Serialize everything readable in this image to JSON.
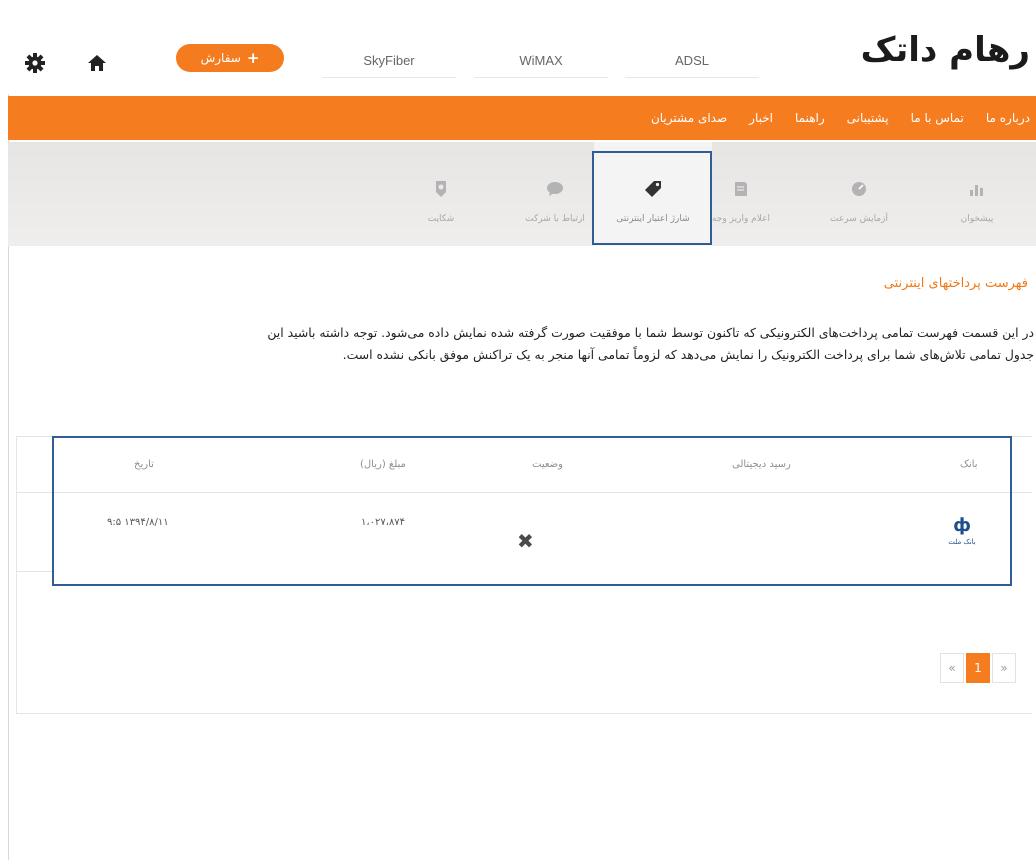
{
  "header": {
    "logo": "رهام داتک",
    "services": [
      "ADSL",
      "WiMAX",
      "SkyFiber"
    ],
    "order_button": "سفارش"
  },
  "nav": {
    "items": [
      "درباره ما",
      "تماس با ما",
      "پشتیبانی",
      "راهنما",
      "اخبار",
      "صدای مشتریان"
    ]
  },
  "tabs": [
    {
      "label": "پیشخوان",
      "icon": "chart-icon"
    },
    {
      "label": "آزمایش سرعت",
      "icon": "speedometer-icon"
    },
    {
      "label": "اعلام واریز وجه",
      "icon": "receipt-icon"
    },
    {
      "label": "شارژ اعتبار اینترنتی",
      "icon": "tag-icon",
      "active": true
    },
    {
      "label": "ارتباط با شرکت",
      "icon": "chat-bubble-icon"
    },
    {
      "label": "شکایت",
      "icon": "badge-icon"
    }
  ],
  "content": {
    "section_title": "فهرست پرداختهای اینترنتی",
    "description_line1": "در این قسمت فهرست تمامی پرداخت‌های الکترونیکی که تاکنون توسط شما با موفقیت صورت گرفته شده نمایش داده می‌شود. توجه داشته باشید این",
    "description_line2": "جدول تمامی تلاش‌های شما برای پرداخت الکترونیک را نمایش می‌دهد که لزوماً تمامی آنها منجر به یک تراکنش موفق بانکی نشده است."
  },
  "table": {
    "headers": {
      "bank": "بانک",
      "receipt": "رسید دیجیتالی",
      "status": "وضعیت",
      "amount": "مبلغ (ریال)",
      "date": "تاریخ"
    },
    "rows": [
      {
        "bank": "بانک ملت",
        "receipt": "",
        "status": "failed",
        "amount": "۱،۰۲۷،۸۷۴",
        "date": "۹:۵ ۱۳۹۴/۸/۱۱"
      }
    ]
  },
  "pagination": {
    "prev": "«",
    "current": "1",
    "next": "»"
  },
  "colors": {
    "brand_orange": "#f57d20",
    "highlight_blue": "#2f5d94"
  }
}
